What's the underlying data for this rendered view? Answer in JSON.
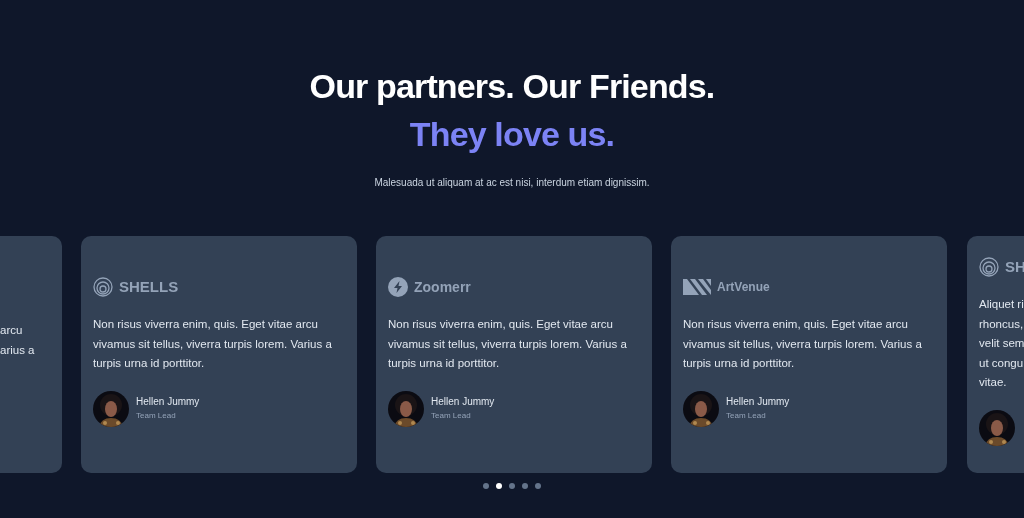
{
  "heading": {
    "title": "Our partners. Our Friends.",
    "highlight": "They love us.",
    "subtitle": "Malesuada ut aliquam at ac est nisi, interdum etiam dignissim."
  },
  "cards": [
    {
      "kind": "edge-left",
      "lines": [
        "arcu",
        "arius a"
      ]
    },
    {
      "kind": "full",
      "logo": {
        "kind": "spiral",
        "name": "SHELLS"
      },
      "quote": "Non risus viverra enim, quis. Eget vitae arcu vivamus sit tellus, viverra turpis lorem. Varius a turpis urna id porttitor.",
      "author": {
        "name": "Hellen Jummy",
        "role": "Team Lead"
      }
    },
    {
      "kind": "full",
      "logo": {
        "kind": "bolt",
        "name": "Zoomerr"
      },
      "quote": "Non risus viverra enim, quis. Eget vitae arcu vivamus sit tellus, viverra turpis lorem. Varius a turpis urna id porttitor.",
      "author": {
        "name": "Hellen Jummy",
        "role": "Team Lead"
      }
    },
    {
      "kind": "full",
      "logo": {
        "kind": "stripes",
        "name": "ArtVenue"
      },
      "quote": "Non risus viverra enim, quis. Eget vitae arcu vivamus sit tellus, viverra turpis lorem. Varius a turpis urna id porttitor.",
      "author": {
        "name": "Hellen Jummy",
        "role": "Team Lead"
      }
    },
    {
      "kind": "edge-right",
      "logo": {
        "kind": "spiral",
        "name": "SH"
      },
      "lines": [
        "Aliquet ri",
        "rhoncus,",
        "velit sem",
        "ut congu",
        "vitae."
      ]
    }
  ],
  "pagination": [
    {
      "selected": false
    },
    {
      "selected": true
    },
    {
      "selected": false
    },
    {
      "selected": false
    },
    {
      "selected": false
    }
  ]
}
